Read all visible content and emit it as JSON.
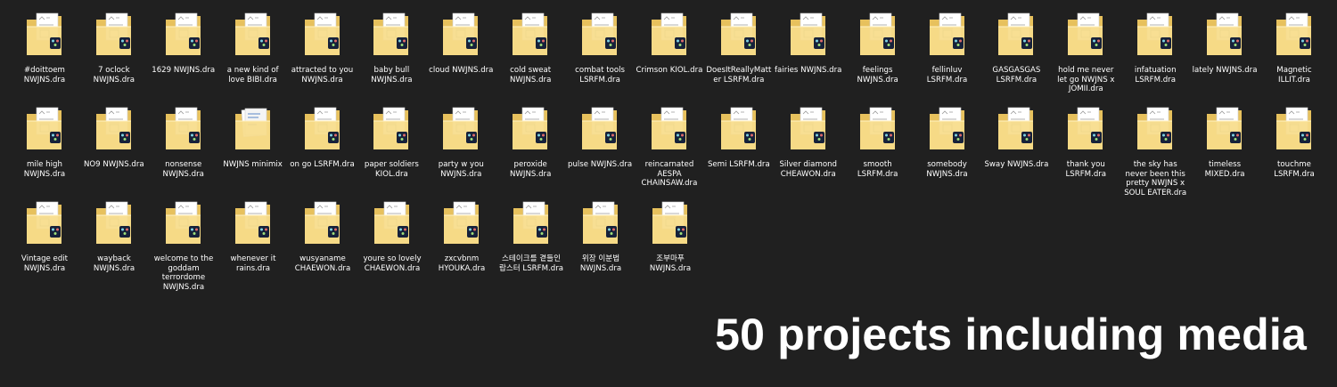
{
  "caption": "50 projects including media",
  "colors": {
    "background": "#202020",
    "folder_back": "#e7c15d",
    "folder_front": "#f7dc8a",
    "paper": "#ffffff",
    "badge": "#16213a",
    "badge_accent": "#7ed3e3",
    "text": "#ffffff"
  },
  "files": [
    {
      "label": "#doittoem NWJNS.dra",
      "kind": "project"
    },
    {
      "label": "7 oclock NWJNS.dra",
      "kind": "project"
    },
    {
      "label": "1629 NWJNS.dra",
      "kind": "project"
    },
    {
      "label": "a new kind of love BIBI.dra",
      "kind": "project"
    },
    {
      "label": "attracted to you NWJNS.dra",
      "kind": "project"
    },
    {
      "label": "baby bull NWJNS.dra",
      "kind": "project"
    },
    {
      "label": "cloud NWJNS.dra",
      "kind": "project"
    },
    {
      "label": "cold sweat NWJNS.dra",
      "kind": "project"
    },
    {
      "label": "combat tools LSRFM.dra",
      "kind": "project"
    },
    {
      "label": "Crimson KIOL.dra",
      "kind": "project"
    },
    {
      "label": "DoesItReallyMatter LSRFM.dra",
      "kind": "project"
    },
    {
      "label": "fairies NWJNS.dra",
      "kind": "project"
    },
    {
      "label": "feelings NWJNS.dra",
      "kind": "project"
    },
    {
      "label": "fellinluv LSRFM.dra",
      "kind": "project"
    },
    {
      "label": "GASGASGAS LSRFM.dra",
      "kind": "project"
    },
    {
      "label": "hold me never let go NWJNS x JOMII.dra",
      "kind": "project"
    },
    {
      "label": "infatuation LSRFM.dra",
      "kind": "project"
    },
    {
      "label": "lately NWJNS.dra",
      "kind": "project"
    },
    {
      "label": "Magnetic ILLIT.dra",
      "kind": "project"
    },
    {
      "label": "mile high NWJNS.dra",
      "kind": "project"
    },
    {
      "label": "NO9 NWJNS.dra",
      "kind": "project"
    },
    {
      "label": "nonsense NWJNS.dra",
      "kind": "project"
    },
    {
      "label": "NWJNS minimix",
      "kind": "folder"
    },
    {
      "label": "on go LSRFM.dra",
      "kind": "project"
    },
    {
      "label": "paper soldiers KIOL.dra",
      "kind": "project"
    },
    {
      "label": "party w you NWJNS.dra",
      "kind": "project"
    },
    {
      "label": "peroxide NWJNS.dra",
      "kind": "project"
    },
    {
      "label": "pulse NWJNS.dra",
      "kind": "project"
    },
    {
      "label": "reincarnated AESPA CHAINSAW.dra",
      "kind": "project"
    },
    {
      "label": "Semi LSRFM.dra",
      "kind": "project"
    },
    {
      "label": "Silver diamond CHEAWON.dra",
      "kind": "project"
    },
    {
      "label": "smooth LSRFM.dra",
      "kind": "project"
    },
    {
      "label": "somebody NWJNS.dra",
      "kind": "project"
    },
    {
      "label": "Sway NWJNS.dra",
      "kind": "project"
    },
    {
      "label": "thank you LSRFM.dra",
      "kind": "project"
    },
    {
      "label": "the sky has never been this pretty NWJNS x SOUL EATER.dra",
      "kind": "project"
    },
    {
      "label": "timeless MIXED.dra",
      "kind": "project"
    },
    {
      "label": "touchme LSRFM.dra",
      "kind": "project"
    },
    {
      "label": "Vintage edit NWJNS.dra",
      "kind": "project"
    },
    {
      "label": "wayback NWJNS.dra",
      "kind": "project"
    },
    {
      "label": "welcome to the goddam terrordome NWJNS.dra",
      "kind": "project"
    },
    {
      "label": "whenever it rains.dra",
      "kind": "project"
    },
    {
      "label": "wusyaname CHAEWON.dra",
      "kind": "project"
    },
    {
      "label": "youre so lovely CHAEWON.dra",
      "kind": "project"
    },
    {
      "label": "zxcvbnm HYOUKA.dra",
      "kind": "project"
    },
    {
      "label": "스테이크를 곁들인 랍스터 LSRFM.dra",
      "kind": "project"
    },
    {
      "label": "위장 이분법 NWJNS.dra",
      "kind": "project"
    },
    {
      "label": "조부마푸 NWJNS.dra",
      "kind": "project"
    }
  ]
}
